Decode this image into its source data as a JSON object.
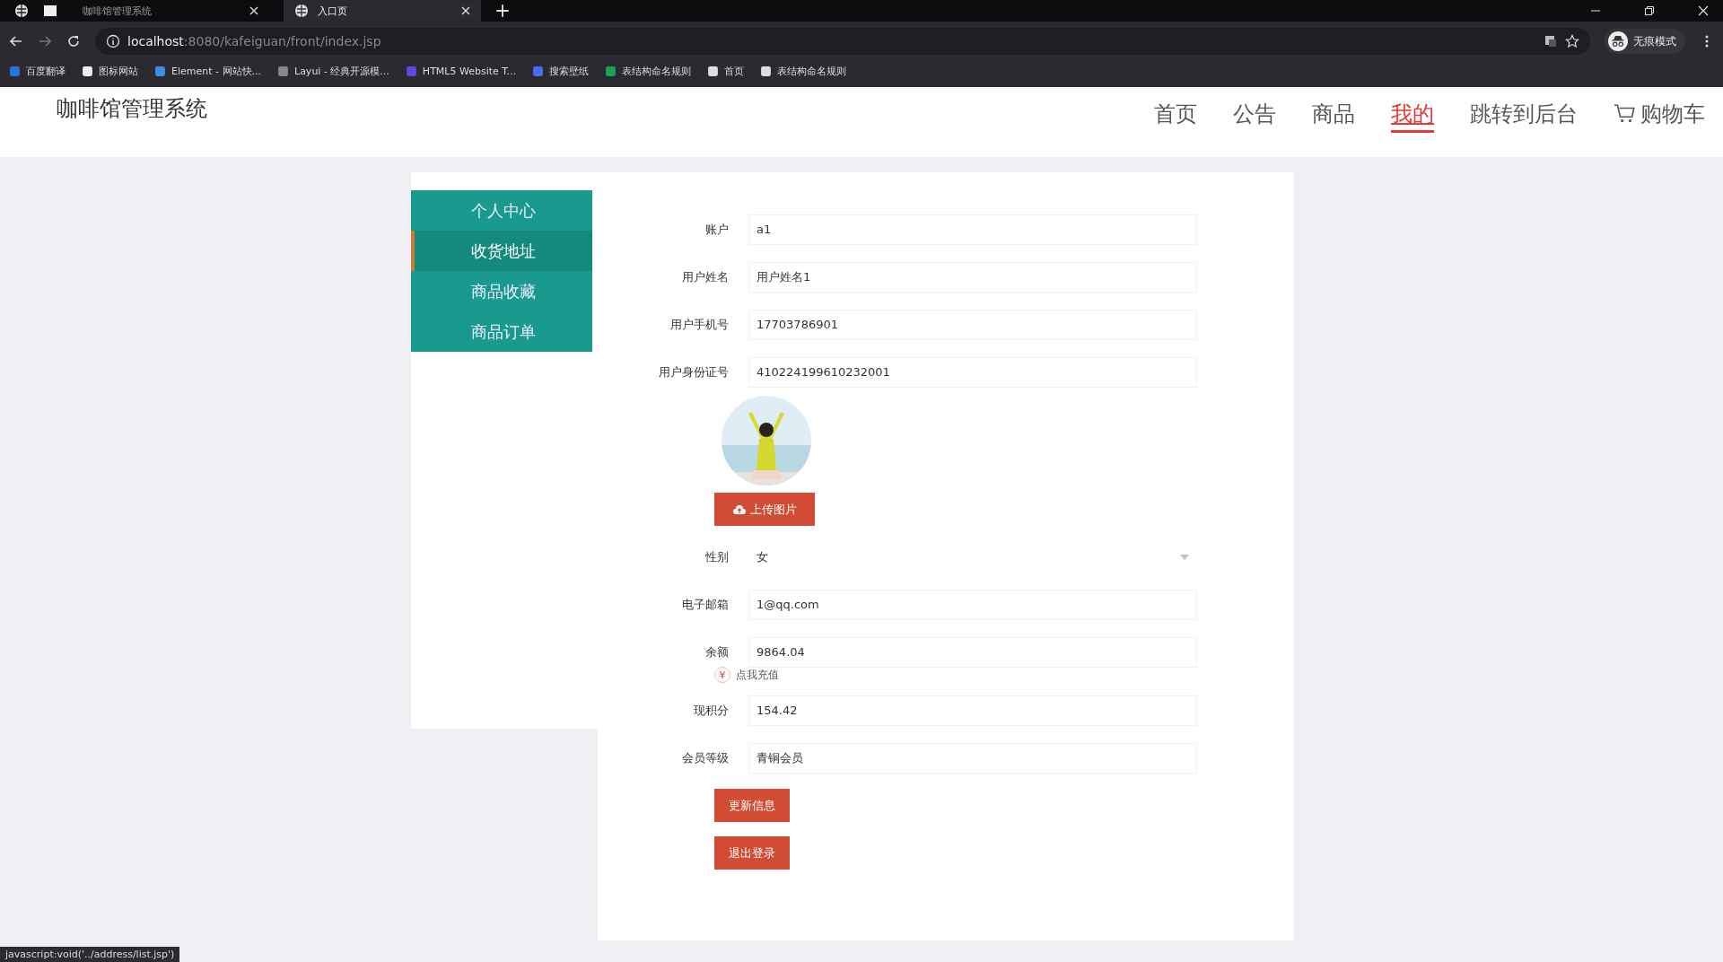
{
  "browser": {
    "tabs": [
      {
        "title": "咖啡馆管理系统",
        "selected": false
      },
      {
        "title": "入口页",
        "selected": true
      }
    ],
    "url_host": "localhost",
    "url_path": ":8080/kafeiguan/front/index.jsp",
    "profile": "无痕模式",
    "bookmarks": [
      "百度翻译",
      "图标网站",
      "Element - 网站快...",
      "Layui - 经典开源模...",
      "HTML5 Website T...",
      "搜索壁纸",
      "表结构命名规则",
      "首页",
      "表结构命名规则"
    ]
  },
  "header": {
    "title": "咖啡馆管理系统",
    "nav": [
      {
        "label": "首页",
        "selected": false
      },
      {
        "label": "公告",
        "selected": false
      },
      {
        "label": "商品",
        "selected": false
      },
      {
        "label": "我的",
        "selected": true
      },
      {
        "label": "跳转到后台",
        "selected": false
      },
      {
        "label": "购物车",
        "selected": false,
        "kind": "cart"
      }
    ]
  },
  "sidebar": [
    {
      "label": "个人中心",
      "selected": false
    },
    {
      "label": "收货地址",
      "selected": true
    },
    {
      "label": "商品收藏",
      "selected": false
    },
    {
      "label": "商品订单",
      "selected": false
    }
  ],
  "form": {
    "fields": [
      {
        "label": "账户",
        "value": "a1"
      },
      {
        "label": "用户姓名",
        "value": "用户姓名1"
      },
      {
        "label": "用户手机号",
        "value": "17703786901"
      },
      {
        "label": "用户身份证号",
        "value": "410224199610232001"
      }
    ],
    "avatar": {
      "kind": "picture"
    },
    "upload_button": "上传图片",
    "fields2": [
      {
        "label": "性别",
        "value": "女",
        "kind": "select"
      },
      {
        "label": "电子邮箱",
        "value": "1@qq.com",
        "kind": "input"
      },
      {
        "label": "余额",
        "value": "9864.04",
        "kind": "input"
      }
    ],
    "recharge_link": "点我充值",
    "recharge_icon": "¥",
    "fields3": [
      {
        "label": "现积分",
        "value": "154.42"
      },
      {
        "label": "会员等级",
        "value": "青铜会员"
      }
    ],
    "buttons": [
      "更新信息",
      "退出登录"
    ]
  },
  "status_bar": "javascript:void('../address/list.jsp')"
}
